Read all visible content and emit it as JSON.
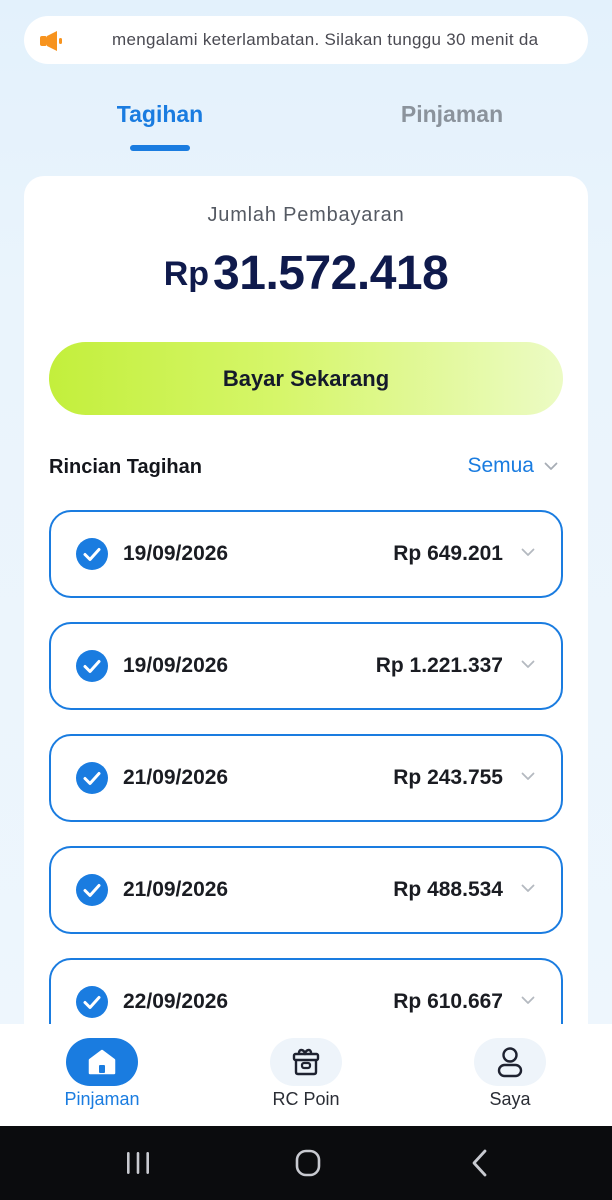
{
  "announcement": {
    "text": "mengalami keterlambatan. Silakan tunggu 30 menit da"
  },
  "tabs": [
    {
      "label": "Tagihan",
      "active": true
    },
    {
      "label": "Pinjaman",
      "active": false
    }
  ],
  "summary": {
    "label": "Jumlah Pembayaran",
    "currency": "Rp",
    "amount": "31.572.418",
    "pay_button": "Bayar Sekarang"
  },
  "details": {
    "title": "Rincian Tagihan",
    "filter": "Semua",
    "items": [
      {
        "date": "19/09/2026",
        "amount": "Rp 649.201",
        "checked": true
      },
      {
        "date": "19/09/2026",
        "amount": "Rp 1.221.337",
        "checked": true
      },
      {
        "date": "21/09/2026",
        "amount": "Rp 243.755",
        "checked": true
      },
      {
        "date": "21/09/2026",
        "amount": "Rp 488.534",
        "checked": true
      },
      {
        "date": "22/09/2026",
        "amount": "Rp 610.667",
        "checked": true
      }
    ]
  },
  "bottom_nav": [
    {
      "label": "Pinjaman",
      "icon": "home-icon",
      "active": true
    },
    {
      "label": "RC Poin",
      "icon": "gift-box-icon",
      "active": false
    },
    {
      "label": "Saya",
      "icon": "person-icon",
      "active": false
    }
  ],
  "colors": {
    "accent": "#1a7ce0",
    "amount_text": "#0f1a4c",
    "pay_button": "#c3ef3c",
    "speaker": "#f7931e"
  }
}
